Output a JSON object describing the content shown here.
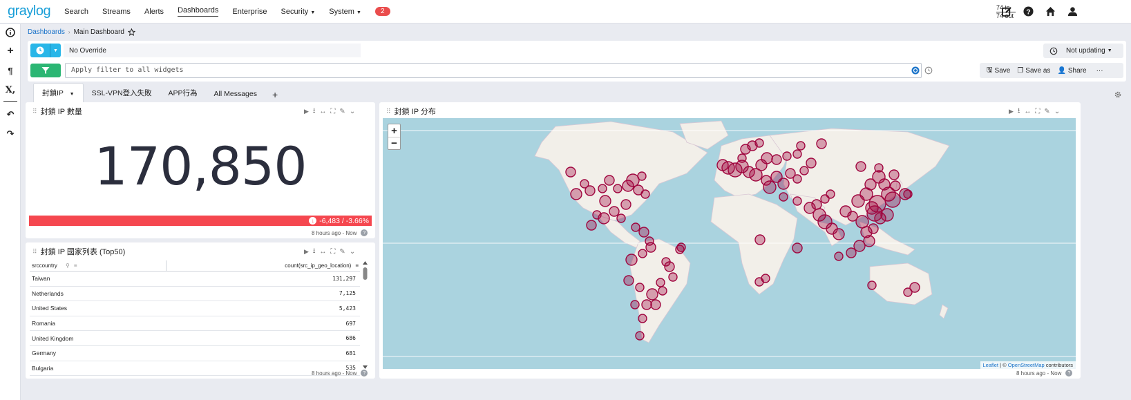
{
  "nav": {
    "logo": "graylog",
    "items": [
      "Search",
      "Streams",
      "Alerts",
      "Dashboards",
      "Enterprise",
      "Security",
      "System"
    ],
    "badge": "2",
    "throughput_in": "74 in",
    "throughput_out": "74 out"
  },
  "breadcrumb": {
    "parent": "Dashboards",
    "current": "Main Dashboard"
  },
  "query": {
    "override": "No Override",
    "not_updating": "Not updating",
    "filter_placeholder": "Apply filter to all widgets",
    "save": "Save",
    "save_as": "Save as",
    "share": "Share",
    "more": "···"
  },
  "tabs": [
    "封鎖IP",
    "SSL-VPN登入失敗",
    "APP行為",
    "All Messages"
  ],
  "tabs_add": "+",
  "widgets": {
    "count": {
      "title": "封鎖 IP 數量",
      "value": "170,850",
      "trend": "-6,483 / -3.66%",
      "timerange": "8 hours ago - Now"
    },
    "table": {
      "title": "封鎖 IP 國家列表 (Top50)",
      "col1": "srccountry",
      "col2": "count(src_ip_geo_location)",
      "rows": [
        {
          "country": "Taiwan",
          "count": "131,297"
        },
        {
          "country": "Netherlands",
          "count": "7,125"
        },
        {
          "country": "United States",
          "count": "5,423"
        },
        {
          "country": "Romania",
          "count": "697"
        },
        {
          "country": "United Kingdom",
          "count": "686"
        },
        {
          "country": "Germany",
          "count": "681"
        },
        {
          "country": "Bulgaria",
          "count": "535"
        }
      ],
      "timerange": "8 hours ago - Now"
    },
    "map": {
      "title": "封鎖 IP 分布",
      "zoom_in": "+",
      "zoom_out": "−",
      "attr_leaflet": "Leaflet",
      "attr_sep": " | © ",
      "attr_osm": "OpenStreetMap",
      "attr_tail": " contributors",
      "timerange": "8 hours ago - Now"
    }
  },
  "colors": {
    "accent": "#1a9fd8",
    "filter": "#2bb673",
    "trend_down": "#f5474f",
    "marker": "#a0063f",
    "ocean": "#aad3df",
    "land": "#f2efe9"
  },
  "icons": [
    "info-icon",
    "plus-icon",
    "pilcrow-icon",
    "function-icon",
    "undo-icon",
    "redo-icon",
    "clock-icon",
    "filter-icon",
    "history-icon",
    "gear-icon"
  ]
}
